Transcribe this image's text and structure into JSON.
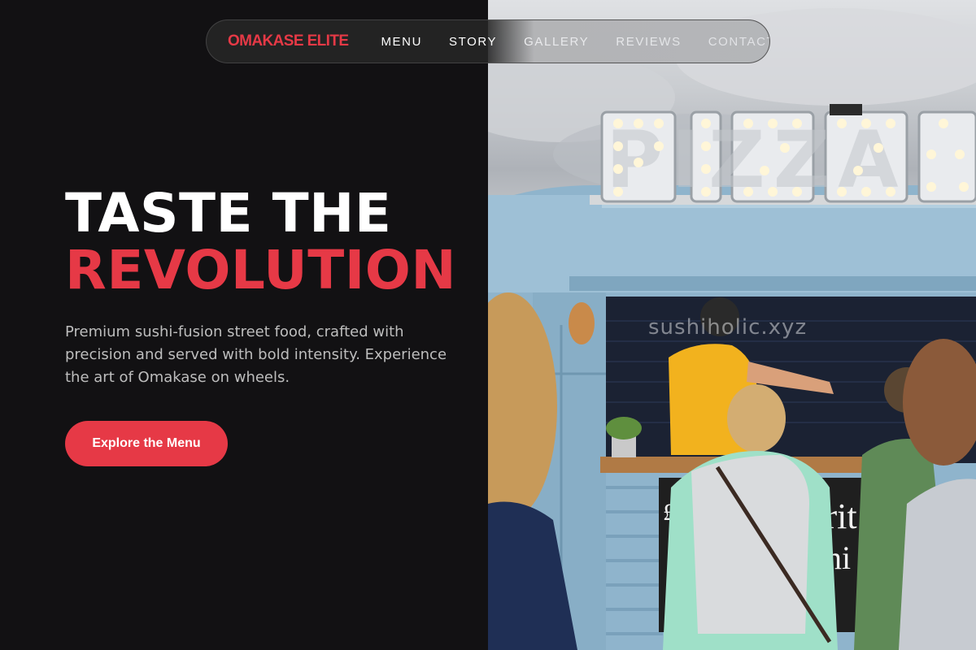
{
  "nav": {
    "brand": "OMAKASE ELITE",
    "links": [
      "MENU",
      "STORY",
      "GALLERY",
      "REVIEWS",
      "CONTACT"
    ]
  },
  "hero": {
    "title_line1": "TASTE THE",
    "title_line2": "REVOLUTION",
    "subtitle": "Premium sushi-fusion street food, crafted with precision and served with bold intensity. Experience the art of Omakase on wheels.",
    "cta_label": "Explore the Menu"
  },
  "photo": {
    "watermark": "sushiholic.xyz",
    "sign_text": "PIZZA"
  },
  "colors": {
    "accent": "#e63946",
    "background": "#121212",
    "text_primary": "#ffffff",
    "text_secondary": "#bdbdbd"
  }
}
